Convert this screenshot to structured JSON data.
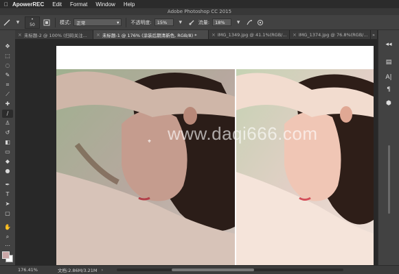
{
  "menubar": {
    "app_name": "ApowerREC",
    "items": [
      "Edit",
      "Format",
      "Window",
      "Help"
    ]
  },
  "titlebar": {
    "title": "Adobe Photoshop CC 2015"
  },
  "options": {
    "brush_size": "50",
    "mode_label": "模式:",
    "mode_value": "正常",
    "opacity_label": "不透明度:",
    "opacity_value": "15%",
    "flow_label": "流量:",
    "flow_value": "18%"
  },
  "tabs": [
    {
      "label": "未标题-2 @ 100% (扫码关注..."
    },
    {
      "label": "未标题-1 @ 176% (涂装后期清新色, RGB/8) *"
    },
    {
      "label": "IMG_1349.jpg @ 41.1%(RGB/..."
    },
    {
      "label": "IMG_1374.jpg @ 76.8%(RGB/..."
    }
  ],
  "watermark": "www.daqi666.com",
  "status": {
    "zoom": "176.41%",
    "doc_info": "文档:2.86M/3.21M"
  },
  "colors": {
    "foreground": "#c9a6a6",
    "background": "#ffffff",
    "ui_dark": "#424242"
  }
}
